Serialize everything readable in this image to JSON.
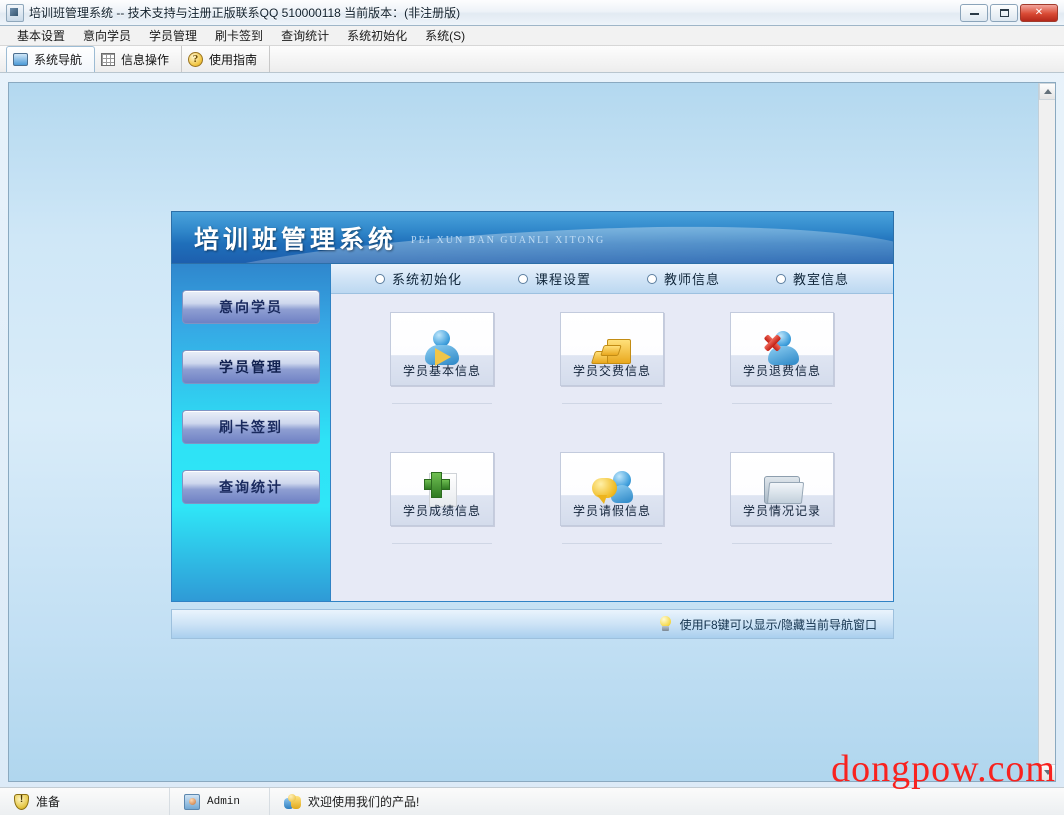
{
  "window": {
    "title": "培训班管理系统 -- 技术支持与注册正版联系QQ 510000118    当前版本：(非注册版)",
    "icon": "app-icon",
    "minimize_label": "",
    "maximize_label": "",
    "close_label": "✕"
  },
  "menubar": {
    "items": [
      {
        "label": "基本设置"
      },
      {
        "label": "意向学员"
      },
      {
        "label": "学员管理"
      },
      {
        "label": "刷卡签到"
      },
      {
        "label": "查询统计"
      },
      {
        "label": "系统初始化"
      },
      {
        "label": "系统(S)"
      }
    ]
  },
  "toolbar": {
    "tabs": [
      {
        "label": "系统导航",
        "icon": "monitor-icon",
        "active": true
      },
      {
        "label": "信息操作",
        "icon": "grid-icon",
        "active": false
      },
      {
        "label": "使用指南",
        "icon": "help-icon",
        "active": false
      }
    ],
    "help_glyph": "?"
  },
  "banner": {
    "title": "培训班管理系统",
    "subtitle": "PEI XUN BAN GUANLI XITONG"
  },
  "sidebar": {
    "buttons": [
      {
        "label": "意向学员"
      },
      {
        "label": "学员管理"
      },
      {
        "label": "刷卡签到"
      },
      {
        "label": "查询统计"
      }
    ]
  },
  "tabs": {
    "options": [
      {
        "label": "系统初始化"
      },
      {
        "label": "课程设置"
      },
      {
        "label": "教师信息"
      },
      {
        "label": "教室信息"
      }
    ]
  },
  "tiles": [
    {
      "label": "学员基本信息",
      "icon": "user-blue-icon"
    },
    {
      "label": "学员交费信息",
      "icon": "gold-bars-icon"
    },
    {
      "label": "学员退费信息",
      "icon": "user-delete-icon"
    },
    {
      "label": "学员成绩信息",
      "icon": "document-add-icon"
    },
    {
      "label": "学员请假信息",
      "icon": "user-chat-icon"
    },
    {
      "label": "学员情况记录",
      "icon": "folder-icon"
    }
  ],
  "hint": {
    "text": "使用F8键可以显示/隐藏当前导航窗口",
    "icon": "lightbulb-icon"
  },
  "statusbar": {
    "cells": [
      {
        "label": "准备",
        "icon": "alert-shield-icon"
      },
      {
        "label": "Admin",
        "icon": "user-account-icon"
      },
      {
        "label": "欢迎使用我们的产品!",
        "icon": "people-icon"
      }
    ]
  },
  "watermark": {
    "text": "dongpow.com"
  },
  "colors": {
    "accent_blue": "#1f6fba",
    "sidebar_cyan": "#2ee2f6",
    "panel_bg": "#e7eaf6",
    "client_bg": "#c3e0f4",
    "watermark_red": "#f8221f",
    "close_red": "#d94a34"
  }
}
